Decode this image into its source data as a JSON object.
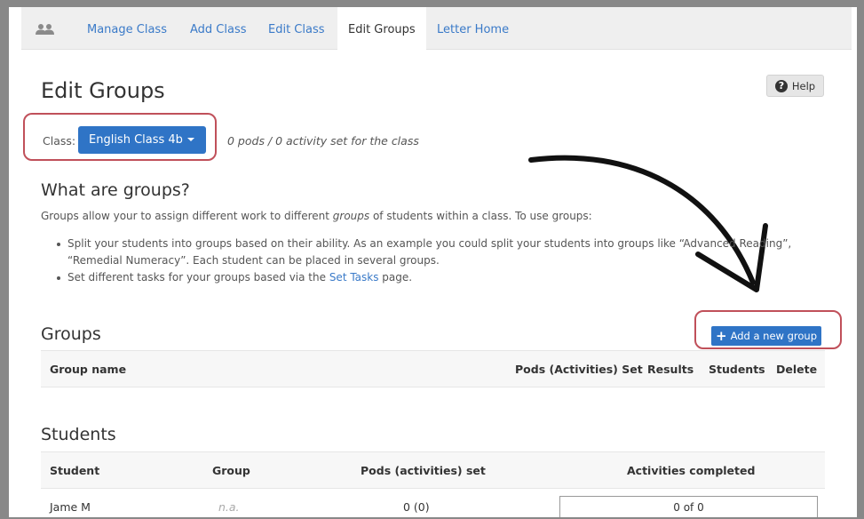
{
  "tabs": [
    {
      "label": "Manage Class",
      "active": false
    },
    {
      "label": "Add Class",
      "active": false
    },
    {
      "label": "Edit Class",
      "active": false
    },
    {
      "label": "Edit Groups",
      "active": true
    },
    {
      "label": "Letter Home",
      "active": false
    }
  ],
  "header": {
    "title": "Edit Groups",
    "help_label": "Help"
  },
  "class_selector": {
    "label": "Class:",
    "value": "English Class 4b",
    "meta": "0 pods / 0 activity set for the class"
  },
  "about": {
    "heading": "What are groups?",
    "intro_before": "Groups allow your to assign different work to different ",
    "intro_em": "groups",
    "intro_after": " of students within a class. To use groups:",
    "bullet1": "Split your students into groups based on their ability. As an example you could split your students into groups like “Advanced Reading”, “Remedial Numeracy”. Each student can be placed in several groups.",
    "bullet2_before": "Set different tasks for your groups based via the ",
    "bullet2_link": "Set Tasks",
    "bullet2_after": " page."
  },
  "groups": {
    "heading": "Groups",
    "add_label": "Add a new group",
    "columns": {
      "name": "Group name",
      "pods": "Pods (Activities) Set",
      "results": "Results",
      "students": "Students",
      "delete": "Delete"
    }
  },
  "students": {
    "heading": "Students",
    "columns": {
      "student": "Student",
      "group": "Group",
      "pods": "Pods (activities) set",
      "completed": "Activities completed"
    },
    "rows": [
      {
        "student": "Jame M",
        "group": "n.a.",
        "pods": "0 (0)",
        "completed": "0 of 0"
      }
    ]
  },
  "colors": {
    "accent": "#2f74c6",
    "link": "#3a7ac8",
    "highlight": "#c0505a"
  }
}
